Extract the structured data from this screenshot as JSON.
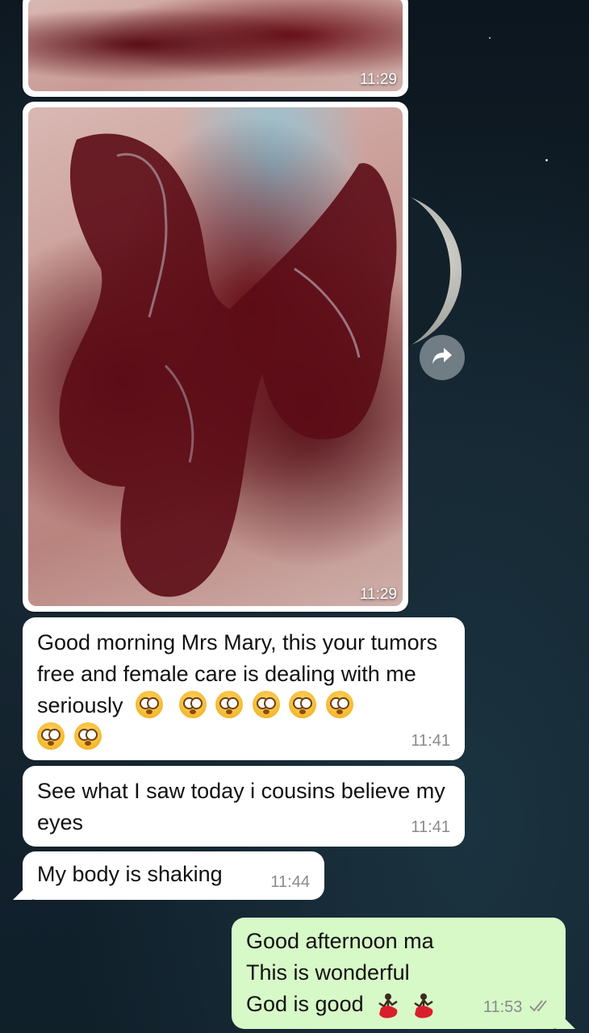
{
  "chat": {
    "background_color": "#13222d",
    "incoming_bubble_color": "#ffffff",
    "outgoing_bubble_color": "#d7f8c7",
    "messages": [
      {
        "type": "image",
        "time": "11:29"
      },
      {
        "type": "image",
        "time": "11:29"
      },
      {
        "type": "text",
        "direction": "in",
        "text": "Good morning Mrs Mary, this your tumors free and female care is dealing with me seriously",
        "emojis": [
          "flushed-face",
          "flushed-face",
          "flushed-face",
          "flushed-face",
          "flushed-face",
          "flushed-face",
          "flushed-face",
          "flushed-face"
        ],
        "time": "11:41"
      },
      {
        "type": "text",
        "direction": "in",
        "text": "See what I saw today i cousins believe my eyes",
        "time": "11:41"
      },
      {
        "type": "text",
        "direction": "in",
        "text": "My body is shaking",
        "time": "11:44"
      },
      {
        "type": "text",
        "direction": "out",
        "lines": [
          "Good afternoon ma",
          "This is wonderful",
          "God is good"
        ],
        "emojis": [
          "dancer",
          "dancer"
        ],
        "time": "11:53",
        "status": "read-double-check"
      }
    ]
  },
  "icons": {
    "forward": "forward-arrow-icon",
    "read_receipt": "double-check-icon"
  }
}
